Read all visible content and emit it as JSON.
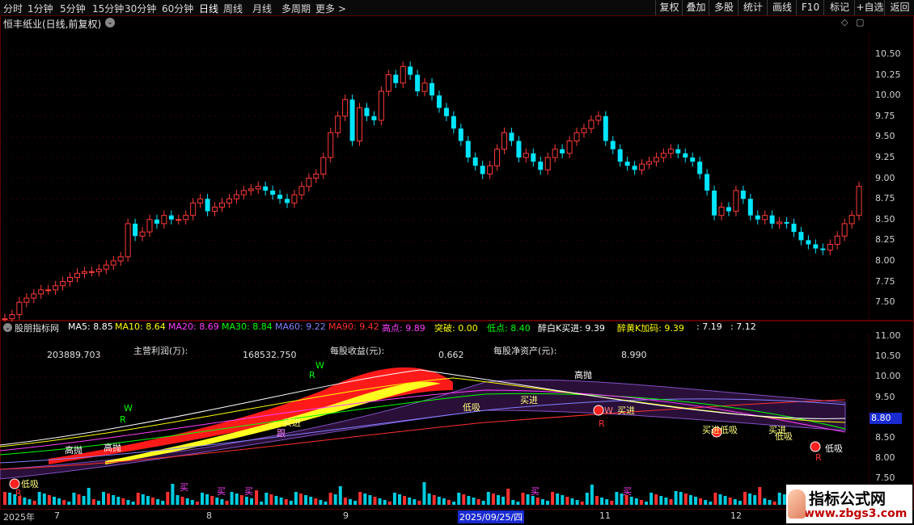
{
  "toolbar": {
    "timeframes": [
      "分时",
      "1分钟",
      "5分钟",
      "15分钟",
      "30分钟",
      "60分钟",
      "日线",
      "周线",
      "月线",
      "多周期",
      "更多 >"
    ],
    "right_buttons": [
      "复权",
      "叠加",
      "多股",
      "统计",
      "画线",
      "F10",
      "标记",
      "+自选",
      "返回"
    ]
  },
  "stock_title": "恒丰纸业(日线,前复权)",
  "price_axis": [
    "10.50",
    "10.25",
    "10.00",
    "9.75",
    "9.50",
    "9.25",
    "9.00",
    "8.75",
    "8.50",
    "8.25",
    "8.00",
    "7.75",
    "7.50"
  ],
  "indicator_name": "股朋指标网",
  "legend": [
    {
      "text": "MA5: 8.85",
      "color": "#ffffff"
    },
    {
      "text": "MA10: 8.64",
      "color": "#ffff00"
    },
    {
      "text": "MA20: 8.69",
      "color": "#ff40ff"
    },
    {
      "text": "MA30: 8.84",
      "color": "#00ff00"
    },
    {
      "text": "MA60: 9.22",
      "color": "#8080ff"
    },
    {
      "text": "MA90: 9.42",
      "color": "#ff3030"
    },
    {
      "text": "高点: 9.89",
      "color": "#ff40ff"
    },
    {
      "text": "突破: 0.00",
      "color": "#ffff00"
    },
    {
      "text": "低点: 8.40",
      "color": "#00ff00"
    },
    {
      "text": "醉白K买进: 9.39",
      "color": "#ffffff"
    },
    {
      "text": "醉黄K加码: 9.39",
      "color": "#ffff00"
    },
    {
      "text": ": 7.19",
      "color": "#ffffff"
    },
    {
      "text": ": 7.12",
      "color": "#ffffff"
    }
  ],
  "ind_axis": [
    "11.00",
    "10.50",
    "10.00",
    "9.50",
    "9.00",
    "8.50",
    "8.00",
    "7.50"
  ],
  "current_price_tag": "8.80",
  "fundamentals": {
    "v1": "203889.703",
    "l1": "主营利润(万):",
    "v2": "168532.750",
    "l2": "每股收益(元):",
    "v3": "0.662",
    "l3": "每股净资产(元):",
    "v4": "8.990"
  },
  "annotations": {
    "gaopao": "高抛",
    "mairu": "买进",
    "dixi": "低吸",
    "gen": "跟",
    "buy": "买",
    "r": "R",
    "w": "W"
  },
  "dates": [
    "2025年",
    "7",
    "8",
    "9",
    "2025/09/25/四",
    "11",
    "12"
  ],
  "watermark": {
    "line1": "指标公式网",
    "line2": "www.zbgs3.com"
  },
  "colors": {
    "up": "#ff3a3a",
    "down": "#00e5ff",
    "bg": "#000000",
    "border": "#5a0000"
  }
}
